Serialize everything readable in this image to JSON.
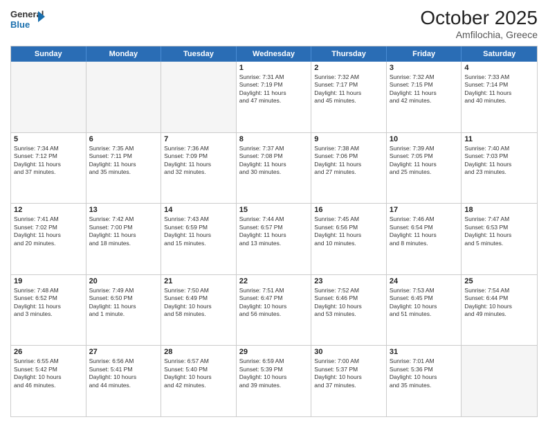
{
  "header": {
    "logo_line1": "General",
    "logo_line2": "Blue",
    "month": "October 2025",
    "location": "Amfilochia, Greece"
  },
  "weekdays": [
    "Sunday",
    "Monday",
    "Tuesday",
    "Wednesday",
    "Thursday",
    "Friday",
    "Saturday"
  ],
  "rows": [
    [
      {
        "day": "",
        "info": ""
      },
      {
        "day": "",
        "info": ""
      },
      {
        "day": "",
        "info": ""
      },
      {
        "day": "1",
        "info": "Sunrise: 7:31 AM\nSunset: 7:19 PM\nDaylight: 11 hours\nand 47 minutes."
      },
      {
        "day": "2",
        "info": "Sunrise: 7:32 AM\nSunset: 7:17 PM\nDaylight: 11 hours\nand 45 minutes."
      },
      {
        "day": "3",
        "info": "Sunrise: 7:32 AM\nSunset: 7:15 PM\nDaylight: 11 hours\nand 42 minutes."
      },
      {
        "day": "4",
        "info": "Sunrise: 7:33 AM\nSunset: 7:14 PM\nDaylight: 11 hours\nand 40 minutes."
      }
    ],
    [
      {
        "day": "5",
        "info": "Sunrise: 7:34 AM\nSunset: 7:12 PM\nDaylight: 11 hours\nand 37 minutes."
      },
      {
        "day": "6",
        "info": "Sunrise: 7:35 AM\nSunset: 7:11 PM\nDaylight: 11 hours\nand 35 minutes."
      },
      {
        "day": "7",
        "info": "Sunrise: 7:36 AM\nSunset: 7:09 PM\nDaylight: 11 hours\nand 32 minutes."
      },
      {
        "day": "8",
        "info": "Sunrise: 7:37 AM\nSunset: 7:08 PM\nDaylight: 11 hours\nand 30 minutes."
      },
      {
        "day": "9",
        "info": "Sunrise: 7:38 AM\nSunset: 7:06 PM\nDaylight: 11 hours\nand 27 minutes."
      },
      {
        "day": "10",
        "info": "Sunrise: 7:39 AM\nSunset: 7:05 PM\nDaylight: 11 hours\nand 25 minutes."
      },
      {
        "day": "11",
        "info": "Sunrise: 7:40 AM\nSunset: 7:03 PM\nDaylight: 11 hours\nand 23 minutes."
      }
    ],
    [
      {
        "day": "12",
        "info": "Sunrise: 7:41 AM\nSunset: 7:02 PM\nDaylight: 11 hours\nand 20 minutes."
      },
      {
        "day": "13",
        "info": "Sunrise: 7:42 AM\nSunset: 7:00 PM\nDaylight: 11 hours\nand 18 minutes."
      },
      {
        "day": "14",
        "info": "Sunrise: 7:43 AM\nSunset: 6:59 PM\nDaylight: 11 hours\nand 15 minutes."
      },
      {
        "day": "15",
        "info": "Sunrise: 7:44 AM\nSunset: 6:57 PM\nDaylight: 11 hours\nand 13 minutes."
      },
      {
        "day": "16",
        "info": "Sunrise: 7:45 AM\nSunset: 6:56 PM\nDaylight: 11 hours\nand 10 minutes."
      },
      {
        "day": "17",
        "info": "Sunrise: 7:46 AM\nSunset: 6:54 PM\nDaylight: 11 hours\nand 8 minutes."
      },
      {
        "day": "18",
        "info": "Sunrise: 7:47 AM\nSunset: 6:53 PM\nDaylight: 11 hours\nand 5 minutes."
      }
    ],
    [
      {
        "day": "19",
        "info": "Sunrise: 7:48 AM\nSunset: 6:52 PM\nDaylight: 11 hours\nand 3 minutes."
      },
      {
        "day": "20",
        "info": "Sunrise: 7:49 AM\nSunset: 6:50 PM\nDaylight: 11 hours\nand 1 minute."
      },
      {
        "day": "21",
        "info": "Sunrise: 7:50 AM\nSunset: 6:49 PM\nDaylight: 10 hours\nand 58 minutes."
      },
      {
        "day": "22",
        "info": "Sunrise: 7:51 AM\nSunset: 6:47 PM\nDaylight: 10 hours\nand 56 minutes."
      },
      {
        "day": "23",
        "info": "Sunrise: 7:52 AM\nSunset: 6:46 PM\nDaylight: 10 hours\nand 53 minutes."
      },
      {
        "day": "24",
        "info": "Sunrise: 7:53 AM\nSunset: 6:45 PM\nDaylight: 10 hours\nand 51 minutes."
      },
      {
        "day": "25",
        "info": "Sunrise: 7:54 AM\nSunset: 6:44 PM\nDaylight: 10 hours\nand 49 minutes."
      }
    ],
    [
      {
        "day": "26",
        "info": "Sunrise: 6:55 AM\nSunset: 5:42 PM\nDaylight: 10 hours\nand 46 minutes."
      },
      {
        "day": "27",
        "info": "Sunrise: 6:56 AM\nSunset: 5:41 PM\nDaylight: 10 hours\nand 44 minutes."
      },
      {
        "day": "28",
        "info": "Sunrise: 6:57 AM\nSunset: 5:40 PM\nDaylight: 10 hours\nand 42 minutes."
      },
      {
        "day": "29",
        "info": "Sunrise: 6:59 AM\nSunset: 5:39 PM\nDaylight: 10 hours\nand 39 minutes."
      },
      {
        "day": "30",
        "info": "Sunrise: 7:00 AM\nSunset: 5:37 PM\nDaylight: 10 hours\nand 37 minutes."
      },
      {
        "day": "31",
        "info": "Sunrise: 7:01 AM\nSunset: 5:36 PM\nDaylight: 10 hours\nand 35 minutes."
      },
      {
        "day": "",
        "info": ""
      }
    ]
  ]
}
